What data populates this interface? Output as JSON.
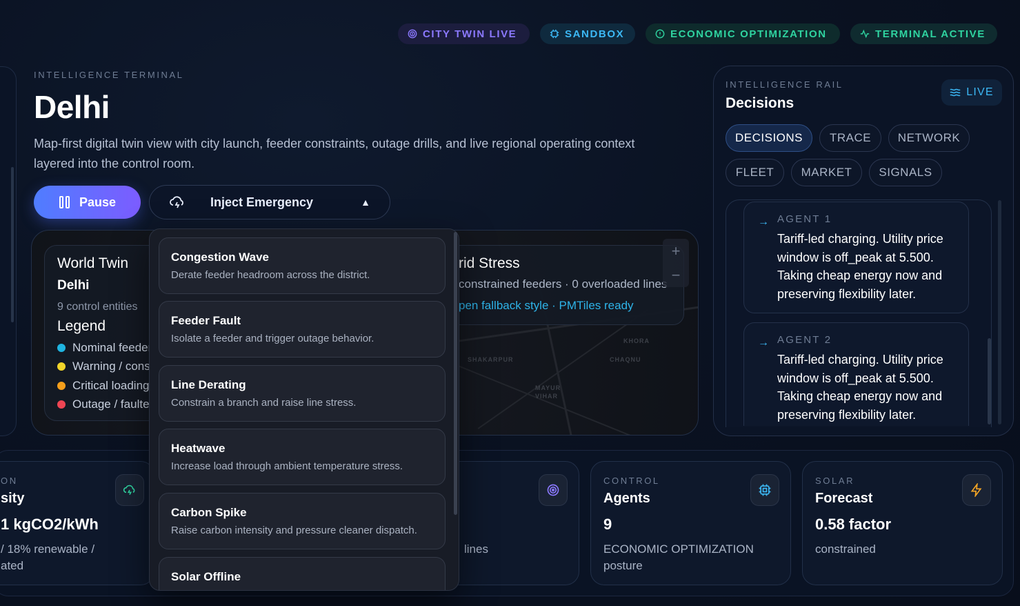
{
  "status_pills": {
    "city": "CITY TWIN LIVE",
    "sandbox": "SANDBOX",
    "econ": "ECONOMIC OPTIMIZATION",
    "terminal": "TERMINAL ACTIVE"
  },
  "main": {
    "eyebrow": "INTELLIGENCE TERMINAL",
    "title": "Delhi",
    "description": "Map-first digital twin view with city launch, feeder constraints, outage drills, and live regional operating context layered into the control room.",
    "pause_label": "Pause",
    "inject_label": "Inject Emergency"
  },
  "map": {
    "world_twin": {
      "title": "World Twin",
      "city": "Delhi",
      "entities": "9 control entities"
    },
    "legend": {
      "title": "Legend",
      "items": [
        {
          "label": "Nominal feeders",
          "color": "#1fb4e0"
        },
        {
          "label": "Warning / constrained",
          "color": "#f2d52a"
        },
        {
          "label": "Critical loading",
          "color": "#f59f1b"
        },
        {
          "label": "Outage / faulted",
          "color": "#ee4553"
        }
      ]
    },
    "grid_stress": {
      "title": "rid Stress",
      "subtitle": "constrained feeders · 0 overloaded lines",
      "link": "pen fallback style · PMTiles ready"
    },
    "zoom_in": "+",
    "zoom_out": "−",
    "labels": [
      "SHAKARPUR",
      "KHORA",
      "CHAQNU",
      "MAYUR VIHAR"
    ]
  },
  "emergency_menu": [
    {
      "title": "Congestion Wave",
      "desc": "Derate feeder headroom across the district."
    },
    {
      "title": "Feeder Fault",
      "desc": "Isolate a feeder and trigger outage behavior."
    },
    {
      "title": "Line Derating",
      "desc": "Constrain a branch and raise line stress."
    },
    {
      "title": "Heatwave",
      "desc": "Increase load through ambient temperature stress."
    },
    {
      "title": "Carbon Spike",
      "desc": "Raise carbon intensity and pressure cleaner dispatch."
    },
    {
      "title": "Solar Offline",
      "desc": ""
    }
  ],
  "rail": {
    "eyebrow": "INTELLIGENCE RAIL",
    "title": "Decisions",
    "live_label": "LIVE",
    "tabs": [
      "DECISIONS",
      "TRACE",
      "NETWORK",
      "FLEET",
      "MARKET",
      "SIGNALS"
    ],
    "agents": [
      {
        "label": "AGENT 1",
        "text": "Tariff-led charging. Utility price window is off_peak at 5.500. Taking cheap energy now and preserving flexibility later."
      },
      {
        "label": "AGENT 2",
        "text": "Tariff-led charging. Utility price window is off_peak at 5.500. Taking cheap energy now and preserving flexibility later."
      }
    ]
  },
  "stats": [
    {
      "eyebrow": "ON",
      "name": "sity",
      "value": "1 kgCO2/kWh",
      "desc": "/ 18% renewable / ated",
      "icon": "cloud-lightning-icon"
    },
    {
      "eyebrow": "",
      "name": "",
      "value": "",
      "desc": "lines",
      "icon": "target-icon"
    },
    {
      "eyebrow": "CONTROL",
      "name": "Agents",
      "value": "9",
      "desc": "ECONOMIC OPTIMIZATION posture",
      "icon": "cpu-icon"
    },
    {
      "eyebrow": "SOLAR",
      "name": "Forecast",
      "value": "0.58 factor",
      "desc": "constrained",
      "icon": "zap-icon"
    }
  ],
  "colors": {
    "accent_blue": "#3cb8f5",
    "accent_green": "#2fd3a0",
    "accent_violet": "#8b79ff"
  }
}
